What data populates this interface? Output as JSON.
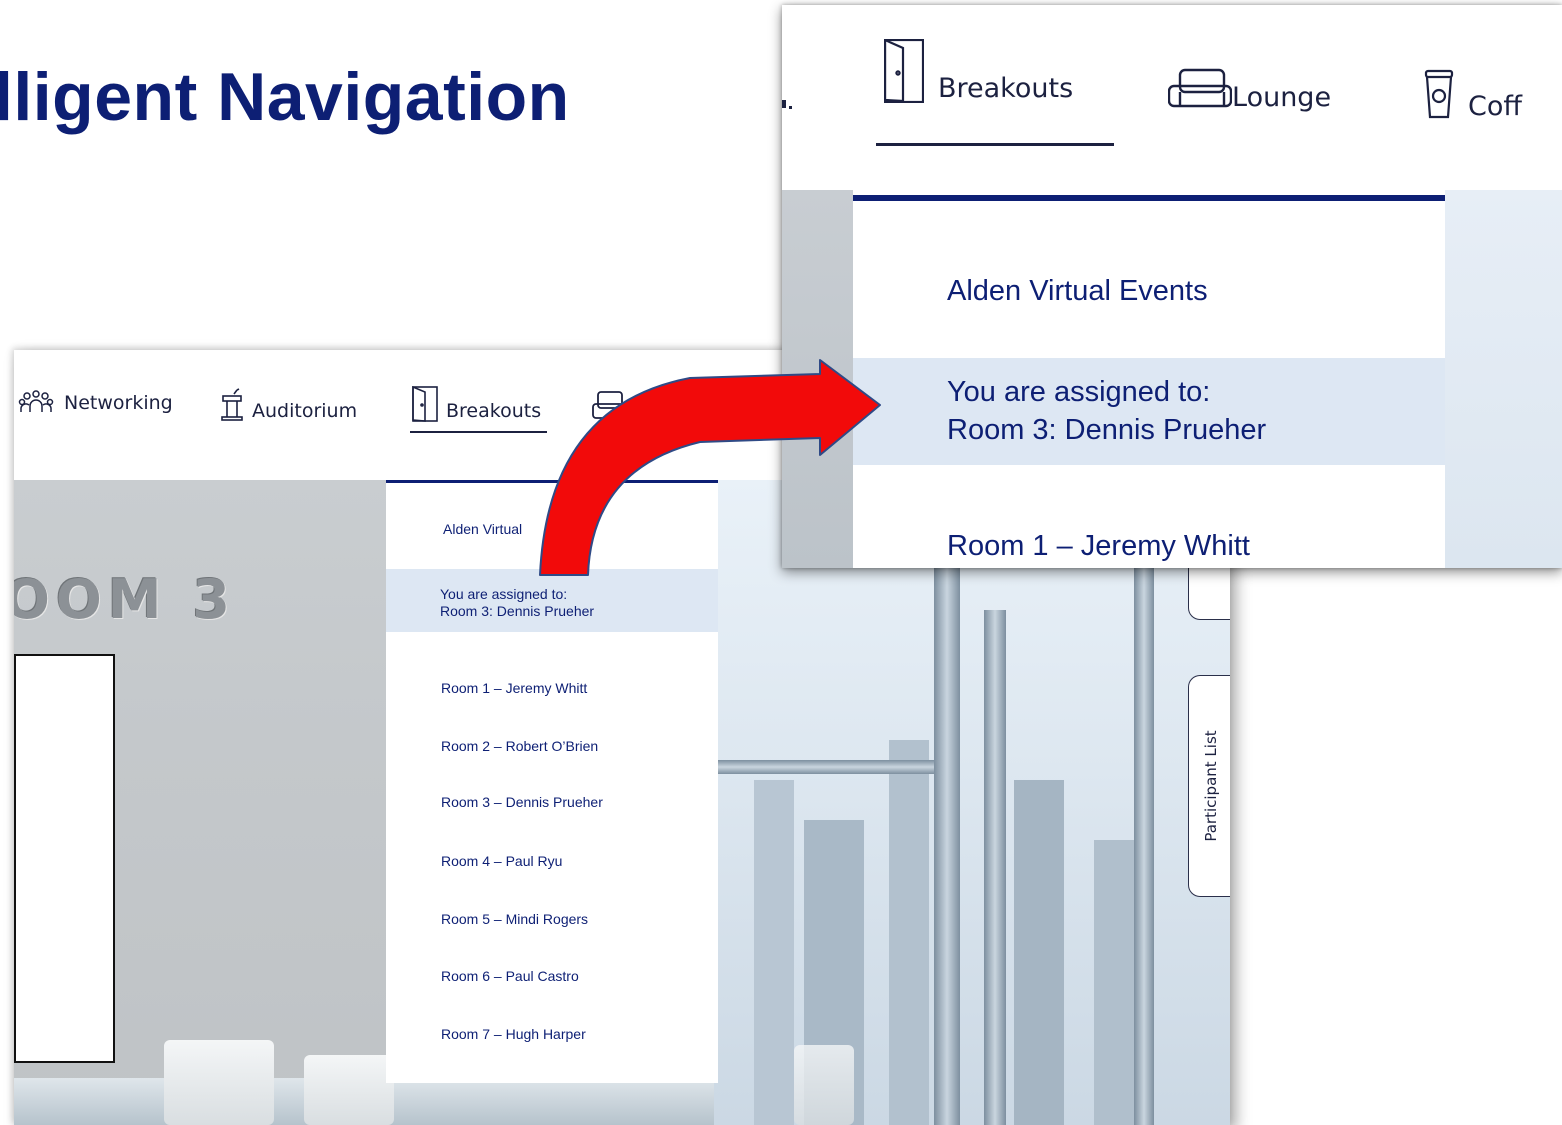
{
  "slide": {
    "title": "lligent Navigation"
  },
  "main_screen": {
    "nav": {
      "networking": "Networking",
      "auditorium": "Auditorium",
      "breakouts": "Breakouts"
    },
    "room_title": "OOM 3",
    "side_tab": "Participant List",
    "dropdown": {
      "brand": "Alden Virtual",
      "assigned_line1": "You are assigned to:",
      "assigned_line2": "Room 3: Dennis Prueher",
      "rooms": [
        "Room 1 – Jeremy Whitt",
        "Room 2 – Robert O’Brien",
        "Room 3 – Dennis Prueher",
        "Room 4 – Paul Ryu",
        "Room 5 – Mindi Rogers",
        "Room 6 – Paul Castro",
        "Room 7 – Hugh Harper"
      ]
    }
  },
  "zoom_inset": {
    "nav": {
      "breakouts": "Breakouts",
      "lounge": "Lounge",
      "coffee": "Coff"
    },
    "dropdown": {
      "brand": "Alden Virtual Events",
      "assigned_line1": "You are assigned to:",
      "assigned_line2": "Room 3: Dennis Prueher",
      "room1": "Room 1 – Jeremy Whitt"
    }
  },
  "colors": {
    "title_navy": "#0d1f74",
    "arrow_red": "#f20a0a",
    "highlight_blue": "#dde7f3"
  }
}
